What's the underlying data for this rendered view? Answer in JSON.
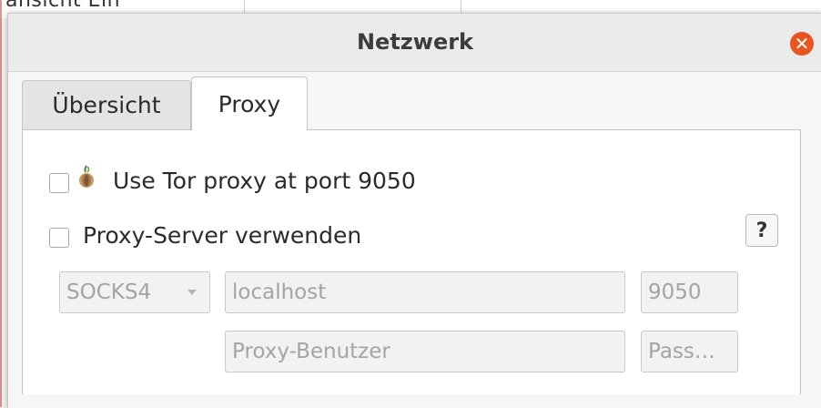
{
  "background_window": {
    "text": "ansicht    Ein"
  },
  "dialog": {
    "title": "Netzwerk",
    "close_icon": "close-icon",
    "close_color": "#e95420"
  },
  "tabs": [
    {
      "label": "Übersicht",
      "active": false
    },
    {
      "label": "Proxy",
      "active": true
    }
  ],
  "proxy": {
    "tor_checkbox": {
      "label": "Use Tor proxy at port 9050",
      "checked": false,
      "icon": "onion-icon"
    },
    "proxy_server_checkbox": {
      "label": "Proxy-Server verwenden",
      "checked": false
    },
    "help_button": "?",
    "type_select": {
      "value": "SOCKS4",
      "enabled": false
    },
    "host_field": {
      "value": "localhost",
      "enabled": false
    },
    "port_field": {
      "value": "9050",
      "enabled": false
    },
    "user_field": {
      "value": "Proxy-Benutzer",
      "enabled": false
    },
    "password_field": {
      "value": "Pass…",
      "enabled": false
    }
  }
}
